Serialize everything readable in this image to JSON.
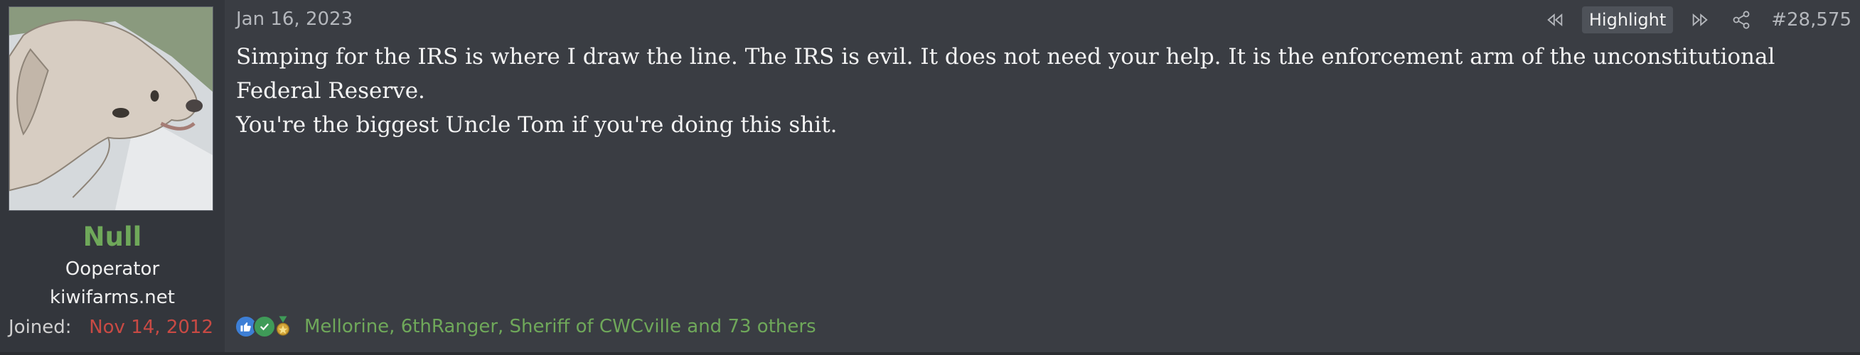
{
  "user": {
    "name": "Null",
    "title": "Ooperator",
    "site": "kiwifarms.net",
    "joined_label": "Joined:",
    "joined_date": "Nov 14, 2012"
  },
  "post": {
    "date": "Jan 16, 2023",
    "number": "#28,575",
    "highlight_label": "Highlight",
    "body": [
      "Simping for the IRS is where I draw the line. The IRS is evil. It does not need your help. It is the enforcement arm of the unconstitutional Federal Reserve.",
      "You're the biggest Uncle Tom if you're doing this shit."
    ]
  },
  "reactions": {
    "icons": [
      "like-icon",
      "check-icon",
      "medal-icon"
    ],
    "text": "Mellorine, 6thRanger, Sheriff of CWCville and 73 others"
  },
  "colors": {
    "background": "#3a3d43",
    "user_column": "#33363c",
    "username": "#6fa85a",
    "joined_date": "#c94a44",
    "reaction_names": "#6fa85a"
  }
}
